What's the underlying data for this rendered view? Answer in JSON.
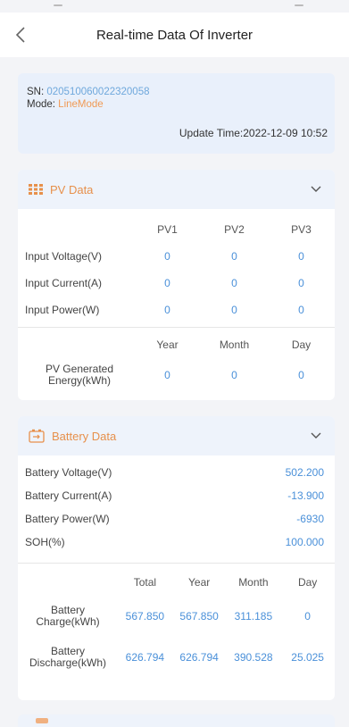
{
  "header": {
    "title": "Real-time Data Of Inverter"
  },
  "device": {
    "sn_label": "SN:",
    "sn": "020510060022320058",
    "mode_label": "Mode:",
    "mode": "LineMode",
    "update_label": "Update Time:",
    "update_time": "2022-12-09 10:52"
  },
  "pv": {
    "title": "PV Data",
    "columns": [
      "PV1",
      "PV2",
      "PV3"
    ],
    "rows": [
      {
        "label": "Input Voltage(V)",
        "values": [
          "0",
          "0",
          "0"
        ]
      },
      {
        "label": "Input Current(A)",
        "values": [
          "0",
          "0",
          "0"
        ]
      },
      {
        "label": "Input Power(W)",
        "values": [
          "0",
          "0",
          "0"
        ]
      }
    ],
    "energy_columns": [
      "Year",
      "Month",
      "Day"
    ],
    "energy_label_1": "PV Generated",
    "energy_label_2": "Energy(kWh)",
    "energy_values": [
      "0",
      "0",
      "0"
    ]
  },
  "battery": {
    "title": "Battery Data",
    "rows": [
      {
        "label": "Battery Voltage(V)",
        "value": "502.200"
      },
      {
        "label": "Battery Current(A)",
        "value": "-13.900"
      },
      {
        "label": "Battery Power(W)",
        "value": "-6930"
      },
      {
        "label": "SOH(%)",
        "value": "100.000"
      }
    ],
    "columns": [
      "Total",
      "Year",
      "Month",
      "Day"
    ],
    "charge_label_1": "Battery",
    "charge_label_2": "Charge(kWh)",
    "charge_values": [
      "567.850",
      "567.850",
      "311.185",
      "0"
    ],
    "discharge_label_1": "Battery",
    "discharge_label_2": "Discharge(kWh)",
    "discharge_values": [
      "626.794",
      "626.794",
      "390.528",
      "25.025"
    ]
  },
  "icons": {
    "back": "chevron-left-icon",
    "pv": "solar-panel-icon",
    "battery": "battery-icon",
    "collapse": "chevron-down-icon"
  },
  "colors": {
    "accent_orange": "#e7904b",
    "value_blue": "#4a90d9",
    "card_tint": "#eef3fb"
  }
}
